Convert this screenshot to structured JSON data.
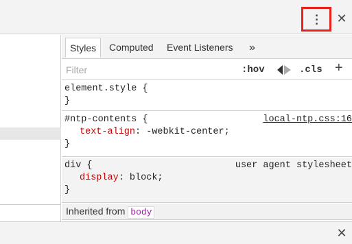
{
  "top_bar": {
    "menu_icon": "vertical-ellipsis-icon",
    "close_icon": "close-icon",
    "close_glyph": "✕"
  },
  "tabs": [
    {
      "label": "Styles",
      "active": true
    },
    {
      "label": "Computed",
      "active": false
    },
    {
      "label": "Event Listeners",
      "active": false
    }
  ],
  "tabs_overflow": "»",
  "filter": {
    "placeholder": "Filter",
    "hov": ":hov",
    "cls": ".cls",
    "add": "+"
  },
  "rules": [
    {
      "selector": "element.style {",
      "close": "}"
    },
    {
      "selector": "#ntp-contents {",
      "source": "local-ntp.css:16",
      "property": "text-align",
      "value": "-webkit-center;",
      "close": "}"
    },
    {
      "selector": "div {",
      "source": "user agent stylesheet",
      "property": "display",
      "value": "block;",
      "close": "}"
    }
  ],
  "inherited": {
    "label": "Inherited from",
    "element": "body"
  },
  "bottom_drawer": {
    "close_glyph": "✕"
  },
  "colors": {
    "highlight": "#e8221b",
    "property": "#c80000",
    "badge": "#9b1fa6"
  }
}
